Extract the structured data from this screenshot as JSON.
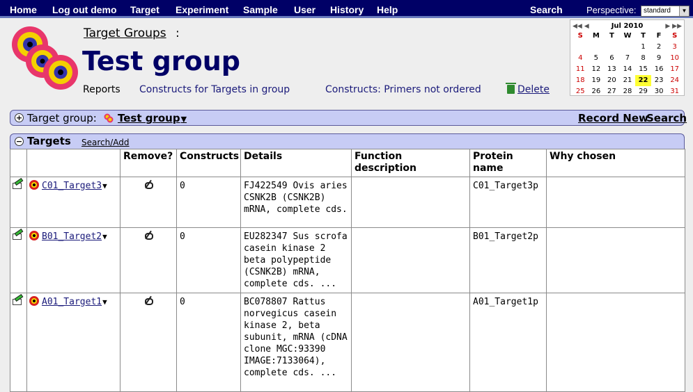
{
  "nav": {
    "items": [
      "Home",
      "Log out demo",
      "Target",
      "Experiment",
      "Sample",
      "User",
      "History",
      "Help"
    ],
    "search": "Search",
    "perspective_label": "Perspective:",
    "perspective_value": "standard"
  },
  "header": {
    "breadcrumb": "Target Groups",
    "colon": ":",
    "title": "Test group",
    "links": {
      "reports": "Reports",
      "constructs": "Constructs for Targets in group",
      "primers": "Constructs: Primers not ordered",
      "delete": "Delete"
    }
  },
  "calendar": {
    "month": "Jul 2010",
    "nav_left": "◀◀ ◀",
    "nav_right": "▶ ▶▶",
    "weekdays": [
      "S",
      "M",
      "T",
      "W",
      "T",
      "F",
      "S"
    ],
    "weeks": [
      [
        "",
        "",
        "",
        "",
        "1",
        "2",
        "3"
      ],
      [
        "4",
        "5",
        "6",
        "7",
        "8",
        "9",
        "10"
      ],
      [
        "11",
        "12",
        "13",
        "14",
        "15",
        "16",
        "17"
      ],
      [
        "18",
        "19",
        "20",
        "21",
        "22",
        "23",
        "24"
      ],
      [
        "25",
        "26",
        "27",
        "28",
        "29",
        "30",
        "31"
      ]
    ],
    "today": "22"
  },
  "group_bar": {
    "label": "Target group:",
    "name": "Test group",
    "record_new": "Record New",
    "search": "Search"
  },
  "targets_bar": {
    "label": "Targets",
    "search_add": "Search/Add"
  },
  "table": {
    "headers": [
      "Remove?",
      "Constructs",
      "Details",
      "Function description",
      "Protein name",
      "Why chosen"
    ],
    "rows": [
      {
        "name": "C01_Target3",
        "constructs": "0",
        "details": "FJ422549 Ovis aries CSNK2B (CSNK2B) mRNA, complete cds.",
        "function": "",
        "protein": "C01_Target3p",
        "why": ""
      },
      {
        "name": "B01_Target2",
        "constructs": "0",
        "details": "EU282347 Sus scrofa casein kinase 2 beta polypeptide (CSNK2B) mRNA, complete cds. ...",
        "function": "",
        "protein": "B01_Target2p",
        "why": ""
      },
      {
        "name": "A01_Target1",
        "constructs": "0",
        "details": "BC078807 Rattus norvegicus casein kinase 2, beta subunit, mRNA (cDNA clone MGC:93390 IMAGE:7133064), complete cds. ...",
        "function": "",
        "protein": "A01_Target1p",
        "why": ""
      }
    ]
  }
}
